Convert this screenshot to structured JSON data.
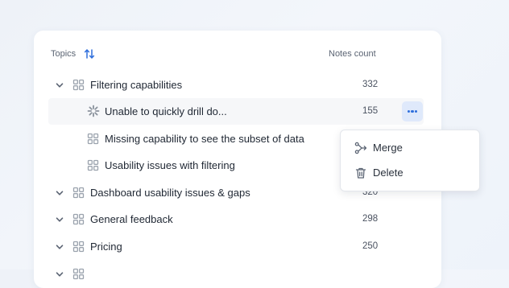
{
  "header": {
    "topics_label": "Topics",
    "notes_count_label": "Notes count"
  },
  "rows": [
    {
      "title": "Filtering capabilities",
      "count": "332"
    },
    {
      "title": "Unable to quickly drill do...",
      "count": "155"
    },
    {
      "title": "Missing capability to see the subset of data"
    },
    {
      "title": "Usability issues with filtering"
    },
    {
      "title": "Dashboard usability issues & gaps",
      "count": "320"
    },
    {
      "title": "General feedback",
      "count": "298"
    },
    {
      "title": "Pricing",
      "count": "250"
    }
  ],
  "context_menu": {
    "items": [
      {
        "label": "Merge"
      },
      {
        "label": "Delete"
      }
    ]
  },
  "colors": {
    "accent": "#2f6fdc",
    "accent_bg": "#dfe9fb",
    "highlight_row": "#f6f7f9",
    "icon_gray": "#9aa2ad"
  },
  "icons": {
    "sort": "sort-arrows-icon",
    "expand": "chevron-down-icon",
    "topic": "grid-icon",
    "loading": "spinner-icon",
    "more": "more-horizontal-icon",
    "merge": "merge-icon",
    "delete": "trash-icon"
  }
}
